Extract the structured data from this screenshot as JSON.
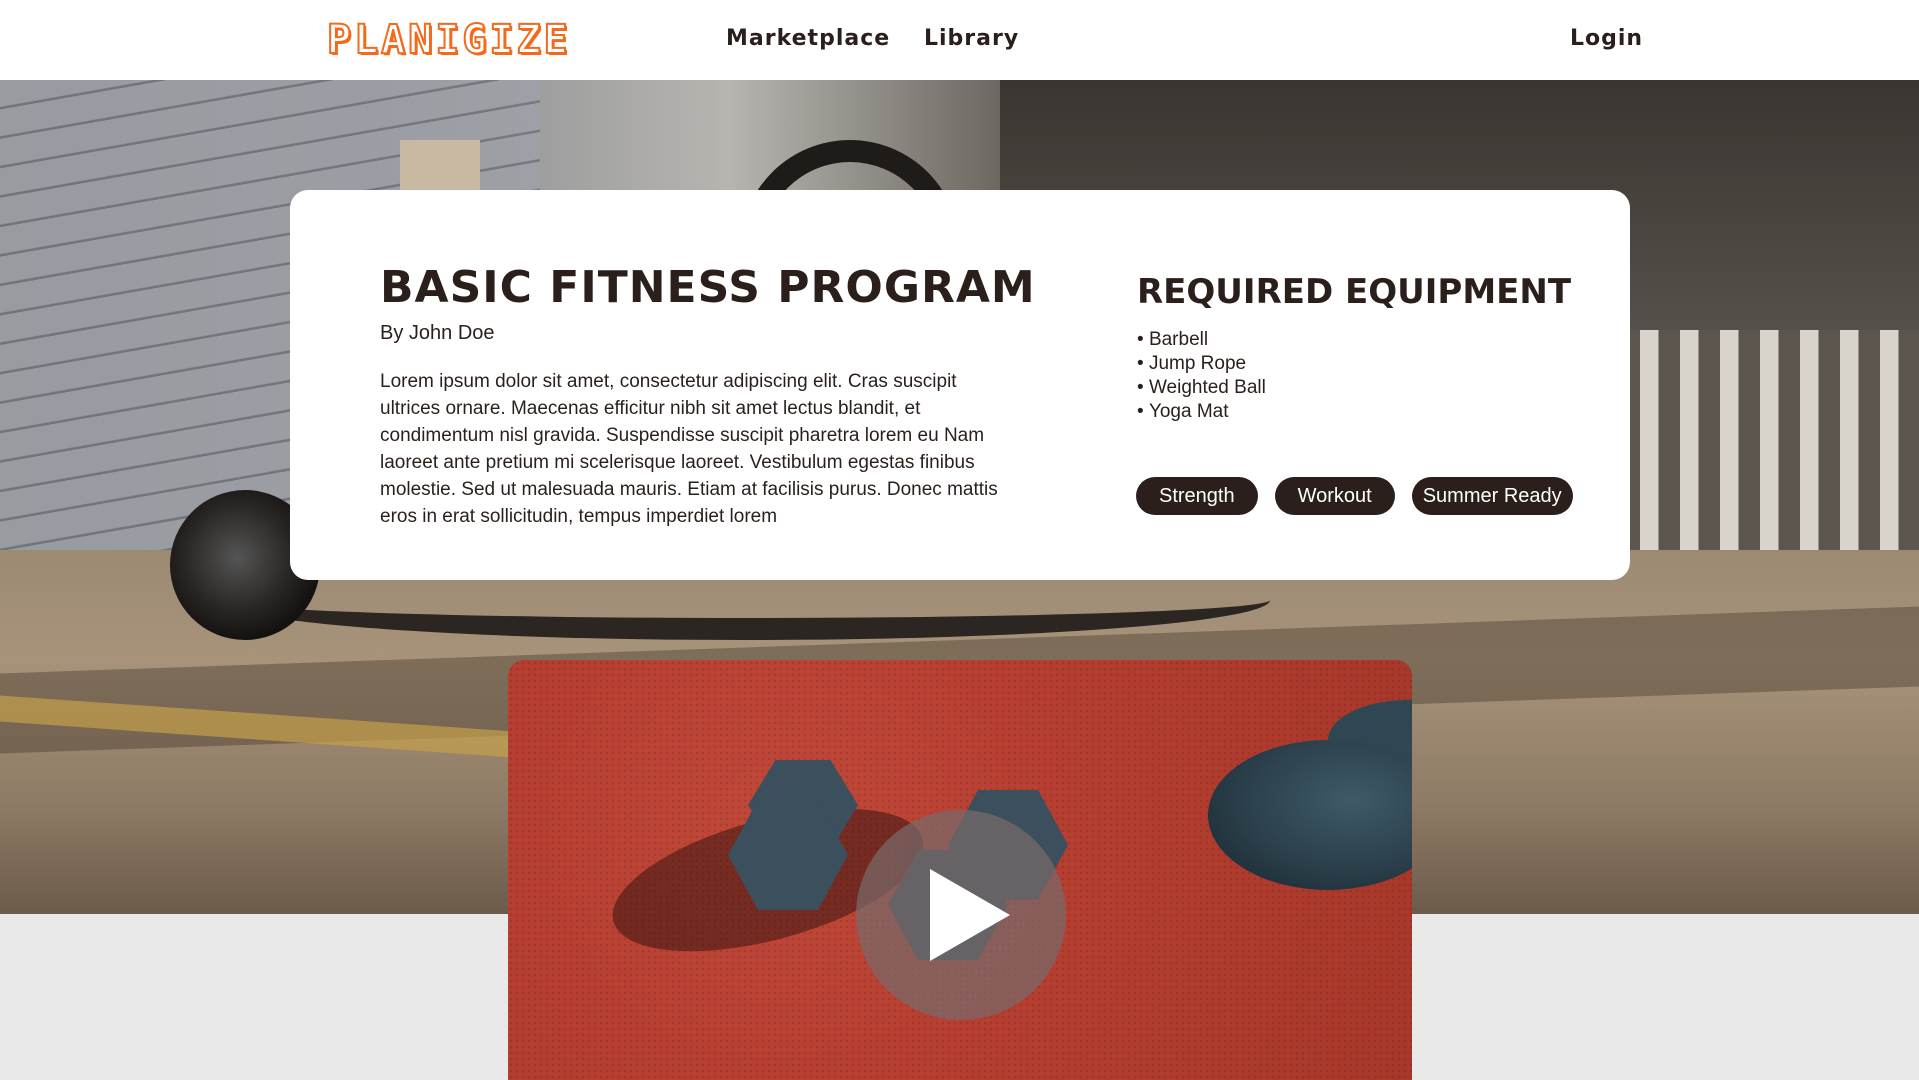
{
  "header": {
    "logo_text": "PLANIGIZE",
    "nav": {
      "marketplace": "Marketplace",
      "library": "Library",
      "login": "Login"
    }
  },
  "program": {
    "title": "Basic Fitness Program",
    "author": "By John Doe",
    "description": "Lorem ipsum dolor sit amet, consectetur adipiscing elit. Cras suscipit ultrices ornare. Maecenas efficitur nibh sit amet lectus blandit, et condimentum nisl gravida. Suspendisse suscipit pharetra lorem eu Nam laoreet ante pretium mi scelerisque laoreet. Vestibulum egestas finibus molestie. Sed ut malesuada mauris. Etiam at facilisis purus. Donec mattis eros in erat sollicitudin, tempus imperdiet lorem"
  },
  "equipment": {
    "title": "Required Equipment",
    "items": [
      "Barbell",
      "Jump Rope",
      "Weighted Ball",
      "Yoga Mat"
    ]
  },
  "tags": [
    "Strength",
    "Workout",
    "Summer Ready"
  ],
  "video": {
    "play_icon": "play-icon"
  },
  "colors": {
    "brand_orange": "#f26a1b",
    "dark_brown": "#2a1f1b",
    "card_bg": "#ffffff",
    "page_bg": "#e9e9e9"
  }
}
